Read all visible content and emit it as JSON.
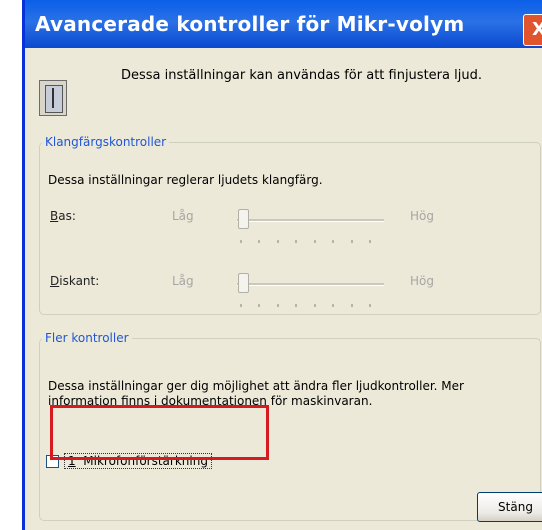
{
  "window": {
    "title": "Avancerade kontroller för Mikr-volym",
    "close_glyph": "X",
    "intro_text": "Dessa inställningar kan användas för att finjustera ljud."
  },
  "tone": {
    "legend": "Klangfärgskontroller",
    "description": "Dessa inställningar reglerar ljudets klangfärg.",
    "bass": {
      "label_access": "B",
      "label_rest": "as:",
      "low": "Låg",
      "high": "Hög",
      "level": 0
    },
    "treble": {
      "label_access": "D",
      "label_rest": "iskant:",
      "low": "Låg",
      "high": "Hög",
      "level": 0
    }
  },
  "more": {
    "legend": "Fler kontroller",
    "description": "Dessa inställningar ger dig möjlighet att ändra fler ljudkontroller. Mer information finns i dokumentationen för maskinvaran.",
    "checkbox": {
      "access": "1",
      "label": "Mikrofonförstärkning",
      "checked": false
    }
  },
  "buttons": {
    "close": "Stäng"
  },
  "colors": {
    "titlebar": "#0a5fe8",
    "legend_blue": "#1f57d8",
    "highlight": "#d71920",
    "dialog_bg": "#ece9d8"
  }
}
